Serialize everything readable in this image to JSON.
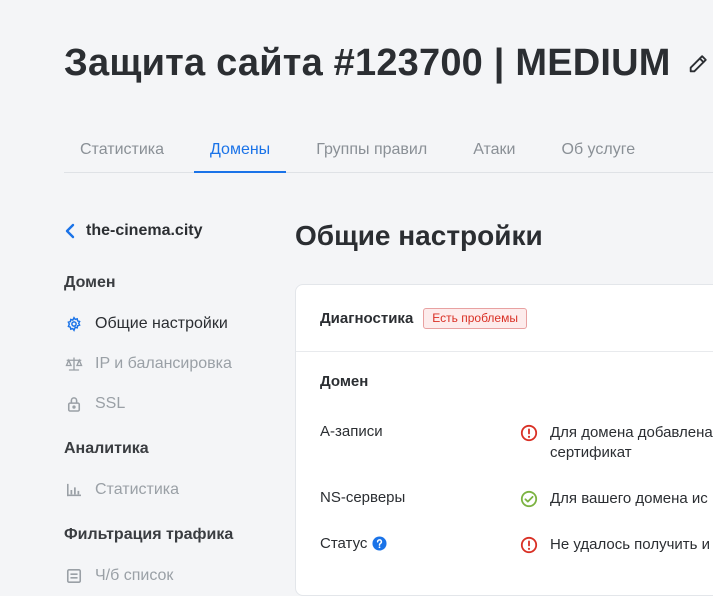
{
  "page": {
    "title": "Защита сайта #123700 | MEDIUM",
    "edit_icon": "pencil-icon"
  },
  "tabs": [
    {
      "label": "Статистика",
      "active": false
    },
    {
      "label": "Домены",
      "active": true
    },
    {
      "label": "Группы правил",
      "active": false
    },
    {
      "label": "Атаки",
      "active": false
    },
    {
      "label": "Об услуге",
      "active": false
    }
  ],
  "sidebar": {
    "back_label": "the-cinema.city",
    "sections": [
      {
        "title": "Домен",
        "items": [
          {
            "label": "Общие настройки",
            "icon": "gear-icon",
            "active": true
          },
          {
            "label": "IP и балансировка",
            "icon": "scales-icon",
            "active": false
          },
          {
            "label": "SSL",
            "icon": "lock-icon",
            "active": false
          }
        ]
      },
      {
        "title": "Аналитика",
        "items": [
          {
            "label": "Статистика",
            "icon": "bar-chart-icon",
            "active": false
          }
        ]
      },
      {
        "title": "Фильтрация трафика",
        "items": [
          {
            "label": "Ч/б список",
            "icon": "list-icon",
            "active": false
          }
        ]
      }
    ]
  },
  "main": {
    "title": "Общие настройки",
    "diagnostics": {
      "label": "Диагностика",
      "badge": "Есть проблемы"
    },
    "domain_section": {
      "title": "Домен",
      "rows": [
        {
          "label": "A-записи",
          "status": "error",
          "value_line1": "Для домена добавлена",
          "value_line2": "сертификат"
        },
        {
          "label": "NS-серверы",
          "status": "ok",
          "value_line1": "Для вашего домена ис"
        },
        {
          "label": "Статус",
          "status": "error",
          "value_line1": "Не удалось получить и",
          "help_icon": "question-icon"
        }
      ]
    }
  },
  "colors": {
    "accent": "#1a73e8",
    "error": "#d93025",
    "success": "#7cb342",
    "background": "#f4f5f7"
  }
}
